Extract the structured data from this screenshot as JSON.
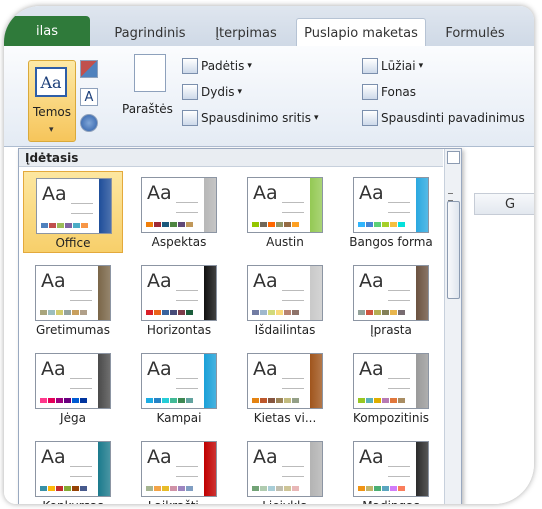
{
  "tabs": [
    {
      "label": "ilas",
      "active": false
    },
    {
      "label": "Pagrindinis",
      "active": false
    },
    {
      "label": "Įterpimas",
      "active": false
    },
    {
      "label": "Puslapio maketas",
      "active": true
    },
    {
      "label": "Formulės",
      "active": false
    }
  ],
  "ribbon": {
    "themes_label": "Temos",
    "themes_icon_text": "Aa",
    "margins_label": "Paraštės",
    "orientation_label": "Padėtis",
    "size_label": "Dydis",
    "print_area_label": "Spausdinimo sritis",
    "breaks_label": "Lūžiai",
    "background_label": "Fonas",
    "print_titles_label": "Spausdinti pavadinimus",
    "font_button_text": "A"
  },
  "sheet": {
    "column_label": "G"
  },
  "gallery": {
    "header": "Įdėtasis",
    "themes": [
      {
        "name": "Office",
        "selected": true,
        "accent": "#1f4e9a",
        "swatches": [
          "#4f81bd",
          "#c0504d",
          "#9bbb59",
          "#8064a2",
          "#4bacc6",
          "#f79646"
        ]
      },
      {
        "name": "Aspektas",
        "selected": false,
        "accent": "#b7b7b7",
        "swatches": [
          "#f07f09",
          "#9f2936",
          "#1b587c",
          "#4e8542",
          "#604878",
          "#c19859"
        ]
      },
      {
        "name": "Austin",
        "selected": false,
        "accent": "#94c954",
        "swatches": [
          "#94c600",
          "#71685a",
          "#ff6700",
          "#909465",
          "#956b43",
          "#fea022"
        ]
      },
      {
        "name": "Bangos forma",
        "selected": false,
        "accent": "#2aa8e0",
        "swatches": [
          "#31b6fd",
          "#4584d3",
          "#5bd078",
          "#a5d028",
          "#f5c040",
          "#05e0db"
        ]
      },
      {
        "name": "Gretimumas",
        "selected": false,
        "accent": "#7a6648",
        "swatches": [
          "#a9a57c",
          "#9cbebd",
          "#d2cb6c",
          "#95a39d",
          "#c89f5d",
          "#b1a089"
        ]
      },
      {
        "name": "Horizontas",
        "selected": false,
        "accent": "#111111",
        "swatches": [
          "#da1f28",
          "#eb641b",
          "#39639d",
          "#474b78",
          "#7d3c4a",
          "#1b5d3b"
        ]
      },
      {
        "name": "Išdailintas",
        "selected": false,
        "accent": "#c9c9c9",
        "swatches": [
          "#727ca3",
          "#9fb8cd",
          "#d2da7a",
          "#fada7a",
          "#b88472",
          "#8e736a"
        ]
      },
      {
        "name": "Įprasta",
        "selected": false,
        "accent": "#6b5240",
        "swatches": [
          "#93a299",
          "#cf543f",
          "#b5ae53",
          "#848058",
          "#e8b54d",
          "#786c71"
        ]
      },
      {
        "name": "Jėga",
        "selected": false,
        "accent": "#4a4a4a",
        "swatches": [
          "#ff388c",
          "#e40059",
          "#9c007f",
          "#68007f",
          "#005bd3",
          "#00349e"
        ]
      },
      {
        "name": "Kampai",
        "selected": false,
        "accent": "#1aa0d8",
        "swatches": [
          "#1cade4",
          "#2683c6",
          "#27ced7",
          "#42ba97",
          "#3e8853",
          "#62a39f"
        ]
      },
      {
        "name": "Kietas vi...",
        "selected": false,
        "accent": "#a0551c",
        "swatches": [
          "#e48312",
          "#bd582c",
          "#865640",
          "#9b8357",
          "#c2bc80",
          "#94a088"
        ]
      },
      {
        "name": "Kompozitinis",
        "selected": false,
        "accent": "#9a9a9a",
        "swatches": [
          "#98c723",
          "#59b0b9",
          "#deae00",
          "#b77bb4",
          "#e0773c",
          "#a98d63"
        ]
      },
      {
        "name": "Konkursas",
        "selected": false,
        "accent": "#1b7a8c",
        "swatches": [
          "#3891a7",
          "#feb80a",
          "#c32d2e",
          "#84aa33",
          "#964305",
          "#475a8d"
        ]
      },
      {
        "name": "Laikrašti...",
        "selected": false,
        "accent": "#c00000",
        "swatches": [
          "#a5b592",
          "#f3a447",
          "#e7bc29",
          "#d092a7",
          "#9c85c0",
          "#809ec2"
        ]
      },
      {
        "name": "Liejykla",
        "selected": false,
        "accent": "#b3b3b3",
        "swatches": [
          "#72a376",
          "#b0ccb0",
          "#a8cdd7",
          "#c0beaf",
          "#cec597",
          "#e8b7b7"
        ]
      },
      {
        "name": "Madingas",
        "selected": false,
        "accent": "#2b2b2b",
        "swatches": [
          "#f09415",
          "#c1b56b",
          "#4baf73",
          "#5aa6c0",
          "#d17df9",
          "#fa7e5c"
        ]
      }
    ]
  }
}
